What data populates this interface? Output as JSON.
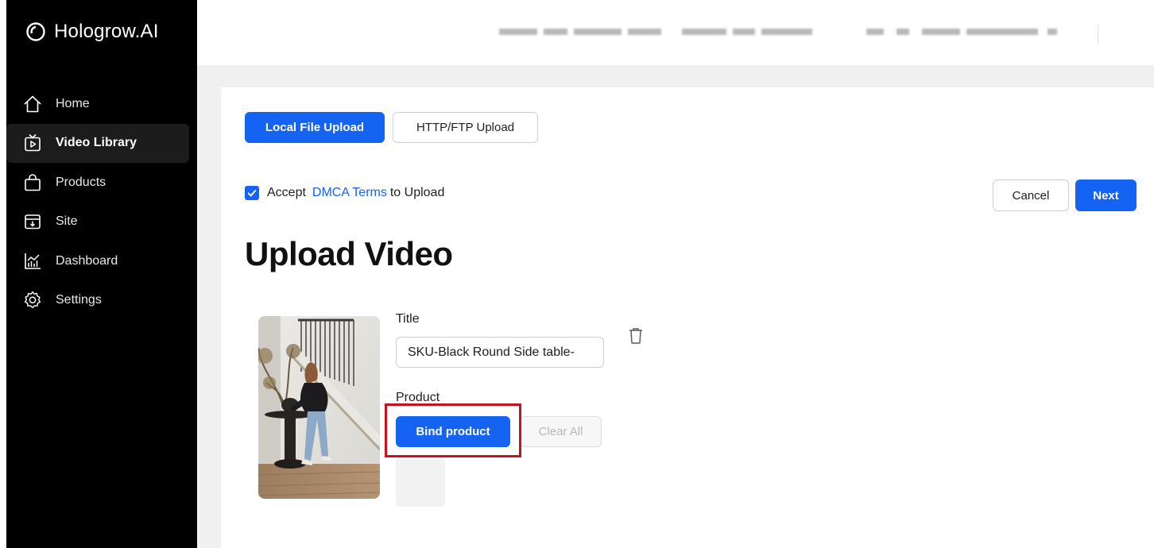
{
  "app": {
    "brand": "Hologrow.AI"
  },
  "sidebar": {
    "items": [
      {
        "label": "Home",
        "icon": "home-icon"
      },
      {
        "label": "Video Library",
        "icon": "video-library-icon",
        "active": true
      },
      {
        "label": "Products",
        "icon": "shopping-bag-icon"
      },
      {
        "label": "Site",
        "icon": "site-icon"
      },
      {
        "label": "Dashboard",
        "icon": "dashboard-icon"
      },
      {
        "label": "Settings",
        "icon": "gear-icon"
      }
    ]
  },
  "upload_tabs": {
    "local": "Local File Upload",
    "http": "HTTP/FTP Upload"
  },
  "accept": {
    "prefix": "Accept",
    "link": "DMCA Terms",
    "suffix": "to Upload",
    "checked": true
  },
  "actions": {
    "cancel": "Cancel",
    "next": "Next"
  },
  "page": {
    "title": "Upload Video"
  },
  "form": {
    "title_label": "Title",
    "title_value": "SKU-Black Round Side table-",
    "product_label": "Product",
    "bind_button": "Bind product",
    "clear_button": "Clear All"
  },
  "colors": {
    "primary": "#1463f3",
    "sidebar_bg": "#000000",
    "highlight": "#c8101e"
  }
}
